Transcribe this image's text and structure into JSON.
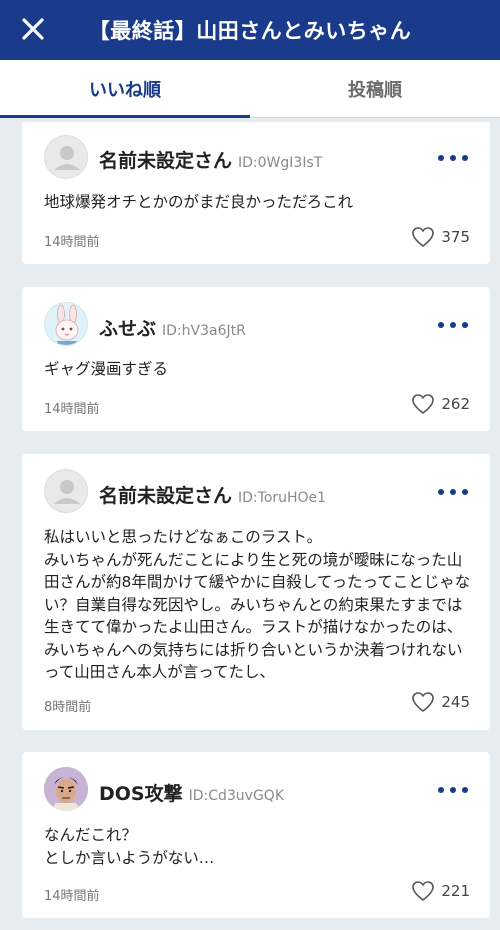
{
  "header": {
    "title": "【最終話】山田さんとみいちゃん"
  },
  "tabs": [
    {
      "label": "いいね順",
      "active": true
    },
    {
      "label": "投稿順",
      "active": false
    }
  ],
  "comments": [
    {
      "name": "名前未設定さん",
      "id": "ID:0WgI3IsT",
      "avatar": "default",
      "body": "地球爆発オチとかのがまだ良かっただろこれ",
      "time": "14時間前",
      "likes": "375"
    },
    {
      "name": "ふせぶ",
      "id": "ID:hV3a6JtR",
      "avatar": "bunny",
      "body": "ギャグ漫画すぎる",
      "time": "14時間前",
      "likes": "262"
    },
    {
      "name": "名前未設定さん",
      "id": "ID:ToruHOe1",
      "avatar": "default",
      "body": "私はいいと思ったけどなぁこのラスト。\nみいちゃんが死んだことにより生と死の境が曖昧になった山田さんが約8年間かけて緩やかに自殺してったってことじゃない？自業自得な死因やし。みいちゃんとの約束果たすまでは生きてて偉かったよ山田さん。ラストが描けなかったのは、みいちゃんへの気持ちには折り合いというか決着つけれないって山田さん本人が言ってたし、",
      "time": "8時間前",
      "likes": "245"
    },
    {
      "name": "DOS攻撃",
      "id": "ID:Cd3uvGQK",
      "avatar": "character",
      "body": "なんだこれ？\nとしか言いようがない…",
      "time": "14時間前",
      "likes": "221"
    }
  ],
  "icons": {
    "close": "close-icon",
    "more": "more-icon",
    "like": "heart-icon",
    "default_avatar": "person-icon"
  },
  "colors": {
    "primary": "#1a3a8c",
    "background": "#e6ecf0"
  }
}
